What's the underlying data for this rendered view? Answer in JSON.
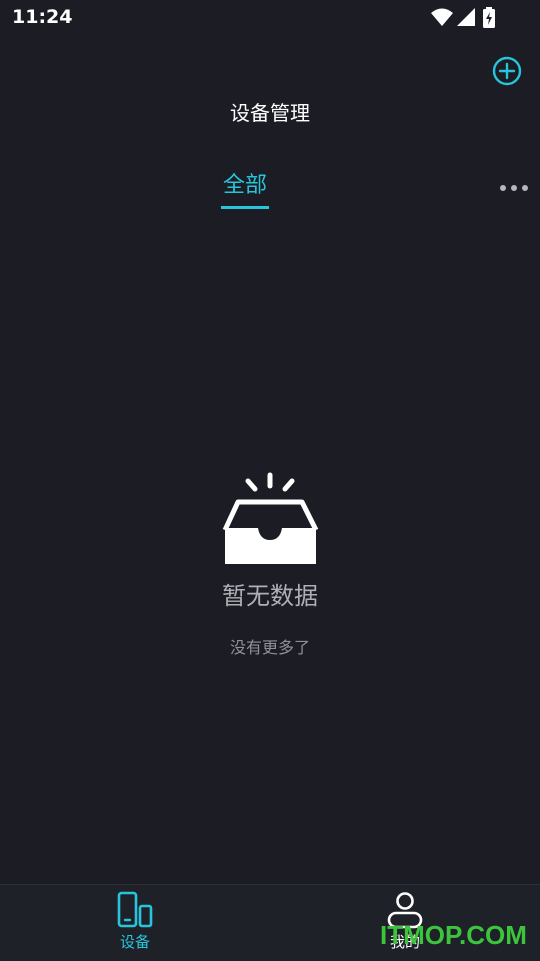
{
  "status_bar": {
    "time": "11:24",
    "icons": [
      "wifi-icon",
      "cellular-signal-icon",
      "battery-charging-icon"
    ]
  },
  "header": {
    "title": "设备管理",
    "add_icon": "plus-circle-icon"
  },
  "tabs": [
    {
      "label": "全部",
      "selected": true
    }
  ],
  "more_icon": "more-horizontal-icon",
  "empty_state": {
    "icon": "empty-inbox-icon",
    "title": "暂无数据",
    "subtitle": "没有更多了"
  },
  "bottom_nav": {
    "items": [
      {
        "label": "设备",
        "icon": "devices-icon",
        "active": true
      },
      {
        "label": "我的",
        "icon": "profile-icon",
        "active": false
      }
    ]
  },
  "watermark": "ITMOP.COM",
  "colors": {
    "background": "#1c1d24",
    "accent": "#27c5dc",
    "text_primary": "#ffffff",
    "text_secondary": "#aeb0b5",
    "watermark": "#3cc43c"
  }
}
